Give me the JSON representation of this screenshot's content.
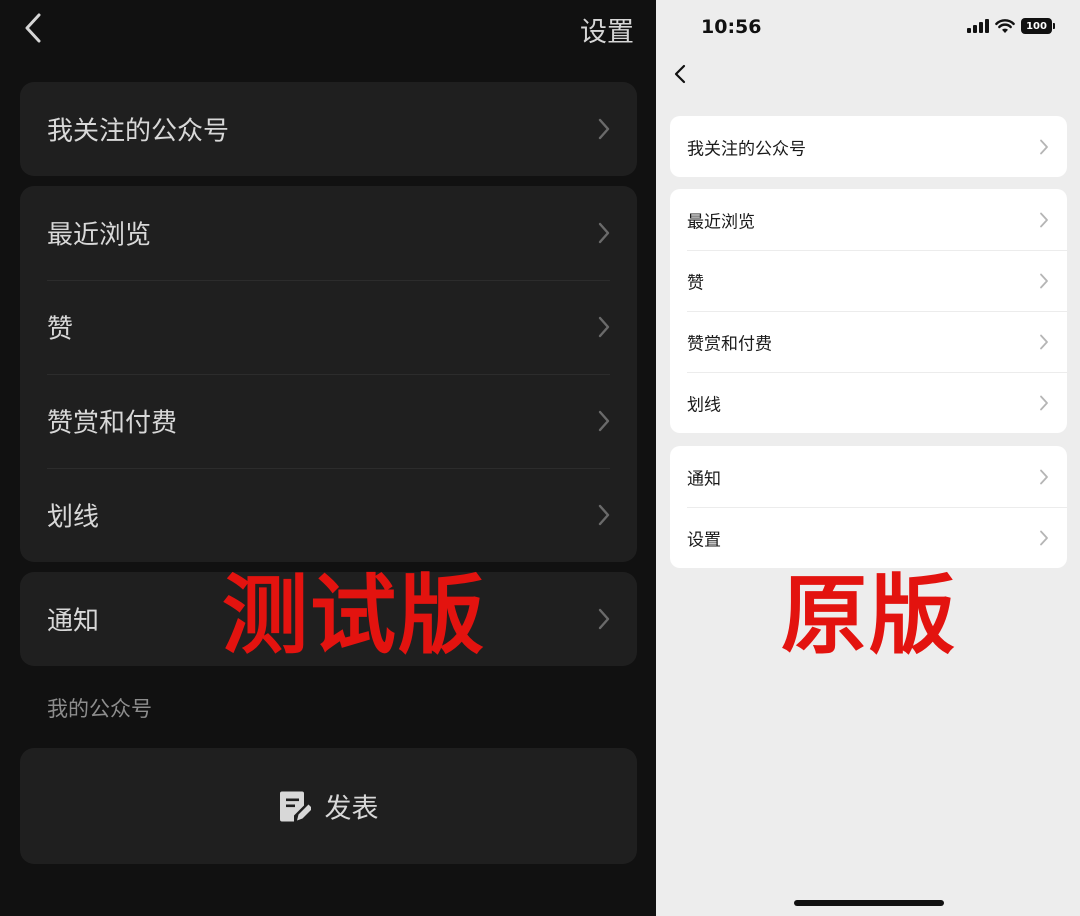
{
  "test_version": {
    "header": {
      "title": "设置"
    },
    "card1": {
      "items": [
        {
          "label": "我关注的公众号"
        }
      ]
    },
    "card2": {
      "items": [
        {
          "label": "最近浏览"
        },
        {
          "label": "赞"
        },
        {
          "label": "赞赏和付费"
        },
        {
          "label": "划线"
        }
      ]
    },
    "card3": {
      "items": [
        {
          "label": "通知"
        }
      ]
    },
    "section_label": "我的公众号",
    "publish": {
      "label": "发表",
      "icon": "compose-icon"
    },
    "watermark": "测试版",
    "colors": {
      "background": "#111111",
      "card": "#1f1f1f",
      "text": "#d8d8d8"
    }
  },
  "original_version": {
    "status_bar": {
      "time": "10:56",
      "battery": "100"
    },
    "card1": {
      "items": [
        {
          "label": "我关注的公众号"
        }
      ]
    },
    "card2": {
      "items": [
        {
          "label": "最近浏览"
        },
        {
          "label": "赞"
        },
        {
          "label": "赞赏和付费"
        },
        {
          "label": "划线"
        }
      ]
    },
    "card3": {
      "items": [
        {
          "label": "通知"
        },
        {
          "label": "设置"
        }
      ]
    },
    "watermark": "原版",
    "colors": {
      "background": "#ededed",
      "card": "#ffffff",
      "text": "#1a1a1a",
      "watermark": "#e3130f"
    }
  }
}
